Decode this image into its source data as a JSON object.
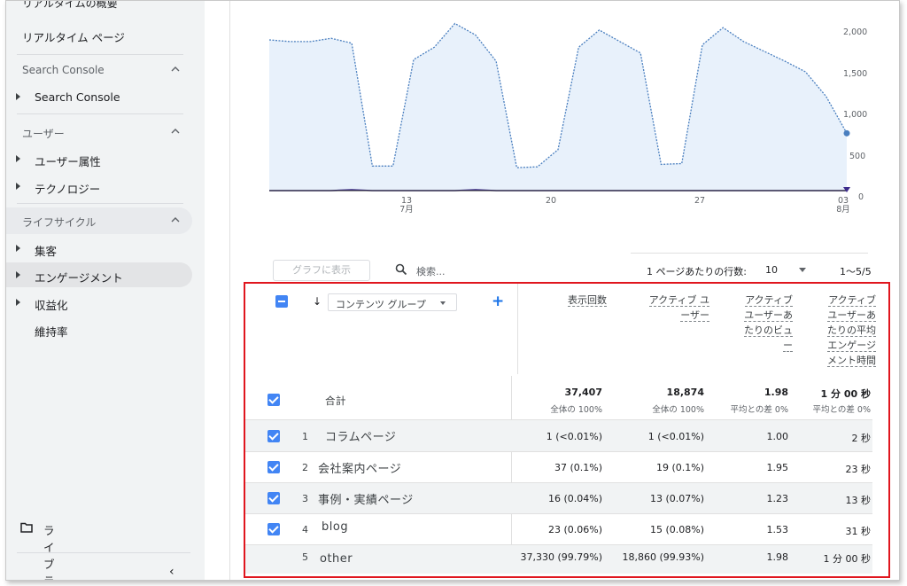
{
  "sidebar": {
    "cut_item": "リアルタイムの概要",
    "realtime_page": "リアルタイム ページ",
    "sections": [
      {
        "label": "Search Console",
        "items": [
          "Search Console"
        ]
      },
      {
        "label": "ユーザー",
        "items": [
          "ユーザー属性",
          "テクノロジー"
        ]
      },
      {
        "label": "ライフサイクル",
        "items": [
          "集客",
          "エンゲージメント",
          "収益化",
          "維持率"
        ]
      }
    ],
    "library": "ライブラリ",
    "collapse_icon": "chevron-left-icon"
  },
  "chart_data": {
    "type": "area",
    "x_tick_labels": [
      "13",
      "7月",
      "20",
      "27",
      "03",
      "8月"
    ],
    "y_ticks": [
      "2,000",
      "1,500",
      "1,000",
      "500",
      "0"
    ],
    "ylim": [
      0,
      2100
    ],
    "series": [
      {
        "values": [
          1840,
          1820,
          1820,
          1860,
          1800,
          300,
          300,
          1600,
          1750,
          2040,
          1900,
          1580,
          280,
          290,
          500,
          1750,
          1960,
          1820,
          1680,
          320,
          330,
          1780,
          1990,
          1820,
          1700,
          1580,
          1450,
          1150,
          700
        ]
      },
      {
        "values": [
          0,
          0,
          0,
          0,
          10,
          0,
          0,
          0,
          0,
          0,
          10,
          0,
          0,
          0,
          0,
          0,
          0,
          0,
          0,
          0,
          0,
          0,
          0,
          0,
          0,
          0,
          0,
          0,
          0
        ]
      }
    ],
    "colors": {
      "fill": "#e8f1fb",
      "line": "#4a7fbf",
      "line2": "#3c2a8c"
    }
  },
  "toolbar": {
    "graph_button": "グラフに表示",
    "search_placeholder": "検索...",
    "rows_per_page_label": "1 ページあたりの行数:",
    "rows_per_page_value": "10",
    "pager": "1〜5/5"
  },
  "table": {
    "dimension_label": "コンテンツ グループ",
    "headers": [
      "表示回数",
      "アクティブ ユーザー",
      "アクティブ ユーザーあたりのビュー",
      "アクティブ ユーザーあたりの平均エンゲージメント時間"
    ],
    "header_lines": [
      [
        "表示回数"
      ],
      [
        "アクティブ ユ",
        "ーザー"
      ],
      [
        "アクティブ",
        "ユーザーあ",
        "たりのビュ",
        "ー"
      ],
      [
        "アクティブ",
        "ユーザーあ",
        "たりの平均",
        "エンゲージ",
        "メント時間"
      ]
    ],
    "total": {
      "label": "合計",
      "values": [
        "37,407",
        "18,874",
        "1.98",
        "1 分 00 秒"
      ],
      "subs": [
        "全体の 100%",
        "全体の 100%",
        "平均との差 0%",
        "平均との差 0%"
      ]
    },
    "rows": [
      {
        "num": "1",
        "name": "コラムページ",
        "values": [
          "1 (<0.01%)",
          "1 (<0.01%)",
          "1.00",
          "2 秒"
        ],
        "checked": true
      },
      {
        "num": "2",
        "name": "会社案内ページ",
        "values": [
          "37 (0.1%)",
          "19 (0.1%)",
          "1.95",
          "23 秒"
        ],
        "checked": true
      },
      {
        "num": "3",
        "name": "事例・実績ページ",
        "values": [
          "16 (0.04%)",
          "13 (0.07%)",
          "1.23",
          "13 秒"
        ],
        "checked": true
      },
      {
        "num": "4",
        "name": "blog",
        "values": [
          "23 (0.06%)",
          "15 (0.08%)",
          "1.53",
          "31 秒"
        ],
        "checked": true
      },
      {
        "num": "5",
        "name": "other",
        "values": [
          "37,330 (99.79%)",
          "18,860 (99.93%)",
          "1.98",
          "1 分 00 秒"
        ],
        "checked": false
      }
    ],
    "highlight_color": "#e0161e",
    "checkbox_color": "#4285f4"
  }
}
